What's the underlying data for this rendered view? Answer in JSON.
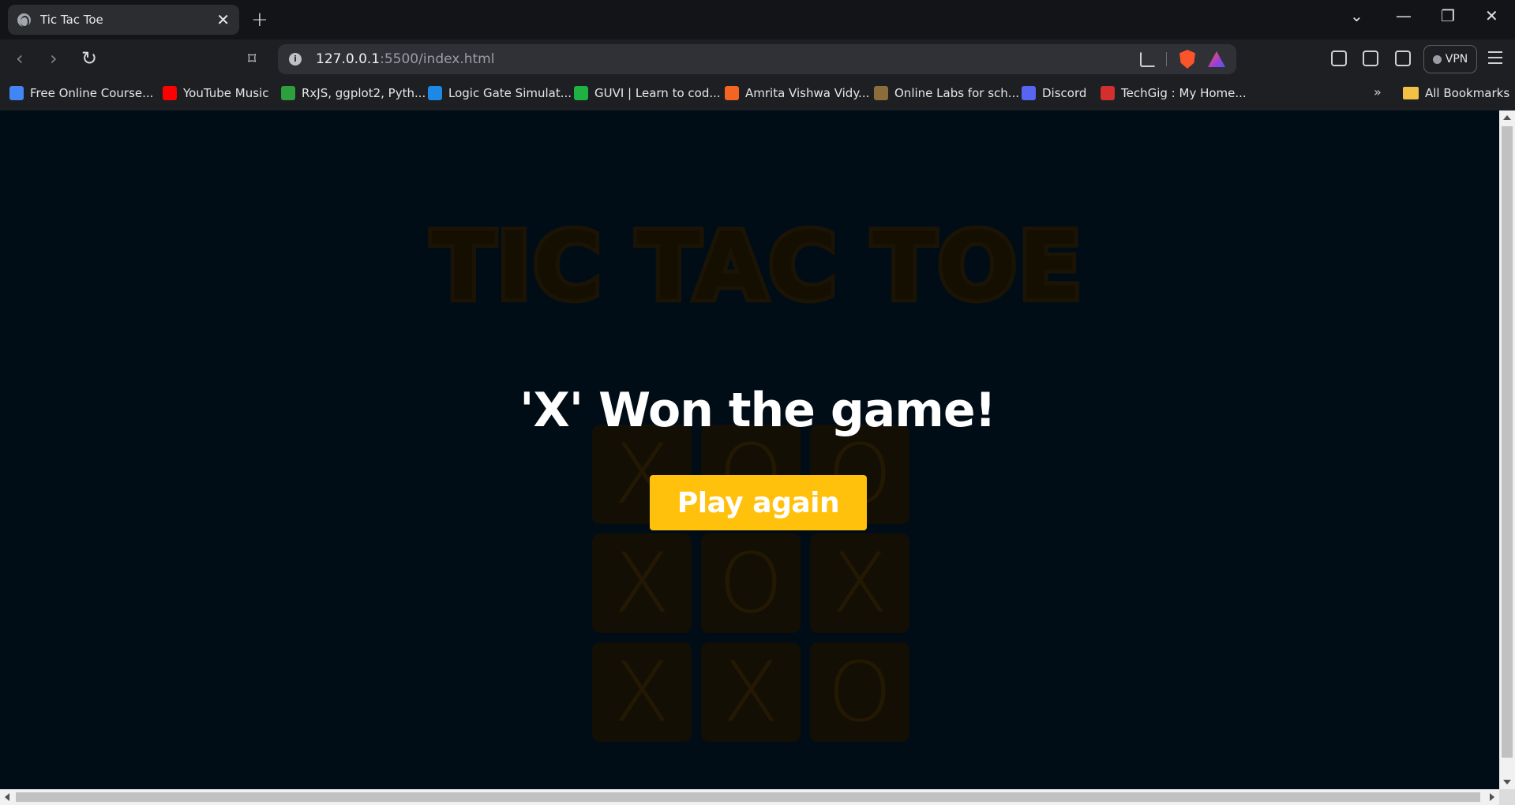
{
  "browser": {
    "tab_title": "Tic Tac Toe",
    "tab_close": "✕",
    "new_tab": "+",
    "url_host": "127.0.0.1",
    "url_rest": ":5500/index.html",
    "vpn_label": "VPN",
    "bookmarks": [
      {
        "label": "Free Online Course...",
        "color": "#4285f4"
      },
      {
        "label": "YouTube Music",
        "color": "#ff0000"
      },
      {
        "label": "RxJS, ggplot2, Pyth...",
        "color": "#2e9e3e"
      },
      {
        "label": "Logic Gate Simulat...",
        "color": "#1e88e5"
      },
      {
        "label": "GUVI | Learn to cod...",
        "color": "#1fb141"
      },
      {
        "label": "Amrita Vishwa Vidy...",
        "color": "#f26522"
      },
      {
        "label": "Online Labs for sch...",
        "color": "#8a6d3b"
      },
      {
        "label": "Discord",
        "color": "#5865f2"
      },
      {
        "label": "TechGig : My Home...",
        "color": "#d32f2f"
      }
    ],
    "bookmarks_overflow": "»",
    "all_bookmarks": "All Bookmarks"
  },
  "page": {
    "title": "TIC TAC TOE",
    "board": [
      "X",
      "O",
      "O",
      "X",
      "O",
      "X",
      "X",
      "X",
      "O"
    ],
    "message": "'X' Won the game!",
    "play_again": "Play again"
  },
  "colors": {
    "accent": "#ffc10c",
    "background": "#000d17"
  }
}
